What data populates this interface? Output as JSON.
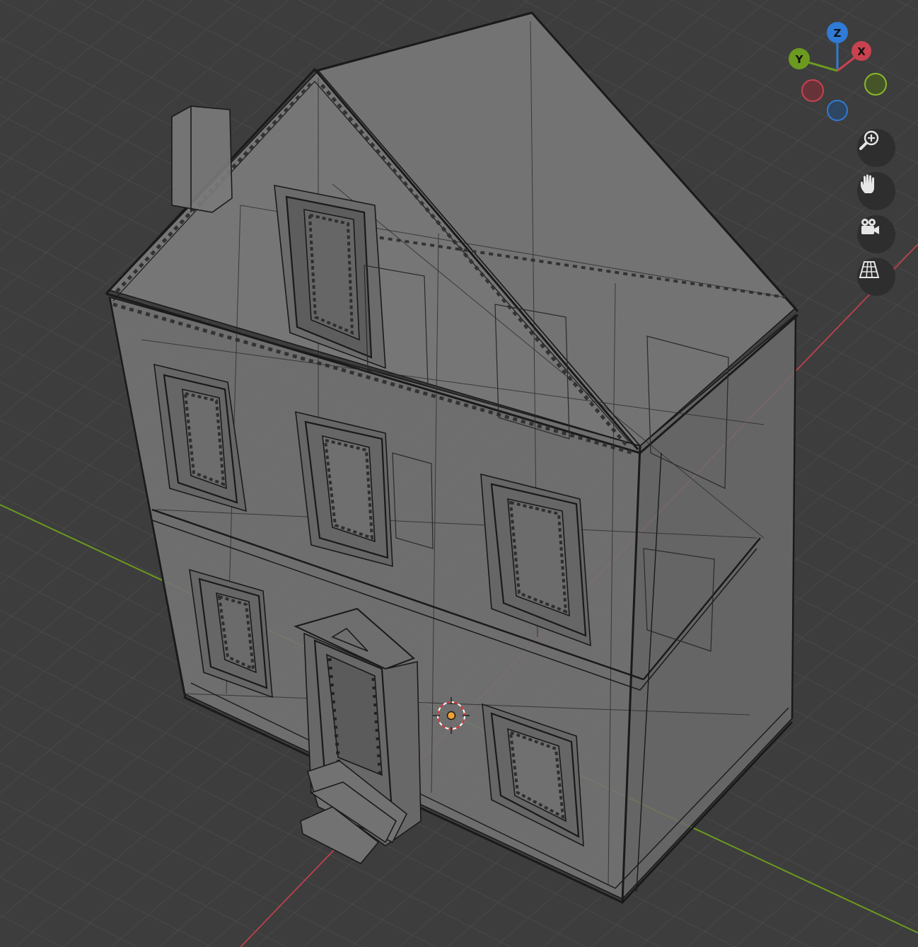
{
  "viewport": {
    "background_color": "#3d3d3d",
    "grid_color": "#505050",
    "x_axis_color": "#c9424f",
    "y_axis_color": "#6b9a1f",
    "object": "house-model",
    "shading": "x-ray wireframe"
  },
  "gizmo": {
    "z_label": "Z",
    "y_label": "Y",
    "x_label": "X",
    "z_color": "#2f7bd6",
    "y_color": "#6b9a1f",
    "x_color": "#c9424f"
  },
  "nav_buttons": [
    {
      "icon": "zoom-in-icon"
    },
    {
      "icon": "hand-pan-icon"
    },
    {
      "icon": "camera-icon"
    },
    {
      "icon": "perspective-grid-icon"
    }
  ],
  "cursor_3d": {
    "color": "#f0a030"
  }
}
